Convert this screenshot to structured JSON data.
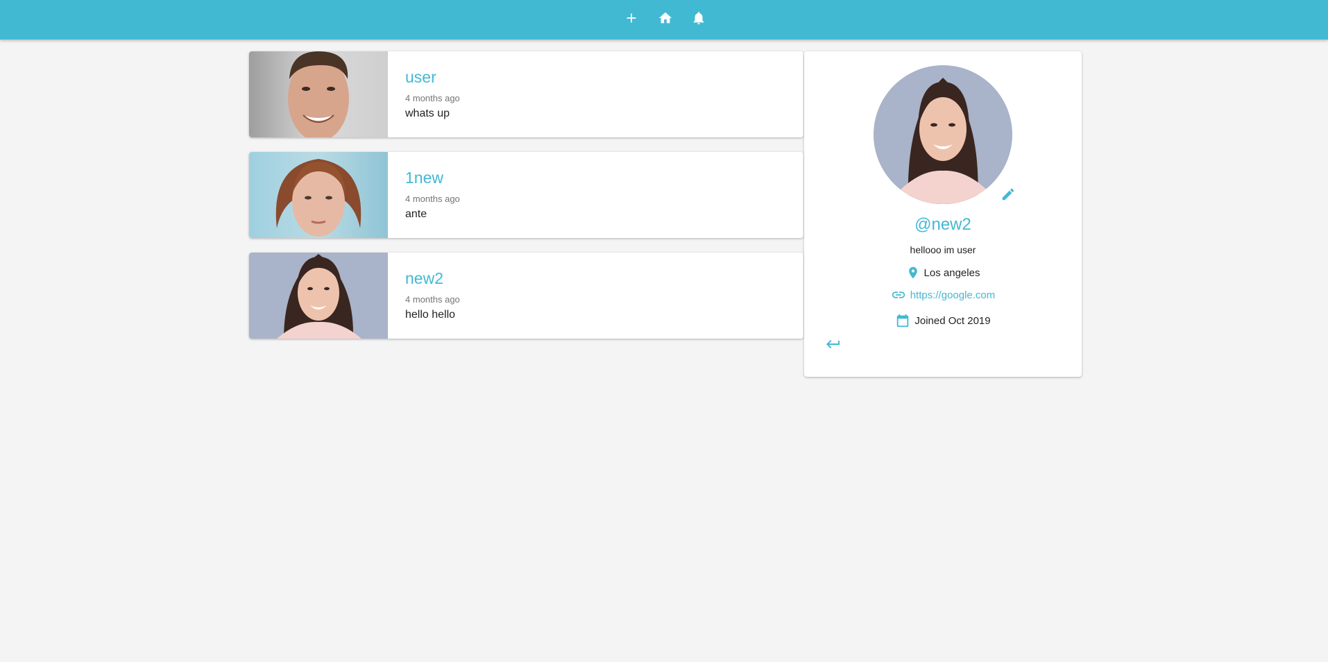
{
  "appbar": {
    "icons": [
      "add-icon",
      "home-icon",
      "notifications-icon"
    ],
    "color": "#42b9d3"
  },
  "posts": [
    {
      "handle": "user",
      "time": "4 months ago",
      "body": "whats up",
      "avatar": "man-photo"
    },
    {
      "handle": "1new",
      "time": "4 months ago",
      "body": "ante",
      "avatar": "red-hair-woman-photo"
    },
    {
      "handle": "new2",
      "time": "4 months ago",
      "body": "hello hello",
      "avatar": "brunette-woman-photo"
    }
  ],
  "profile": {
    "handle": "@new2",
    "bio": "hellooo im user",
    "location": "Los angeles",
    "website": "https://google.com",
    "joined": "Joined Oct 2019",
    "icons": [
      "edit-icon",
      "location-icon",
      "link-icon",
      "calendar-icon",
      "logout-icon"
    ]
  },
  "colors": {
    "accent": "#42b9d3",
    "background": "#f4f4f4",
    "card": "#ffffff"
  }
}
